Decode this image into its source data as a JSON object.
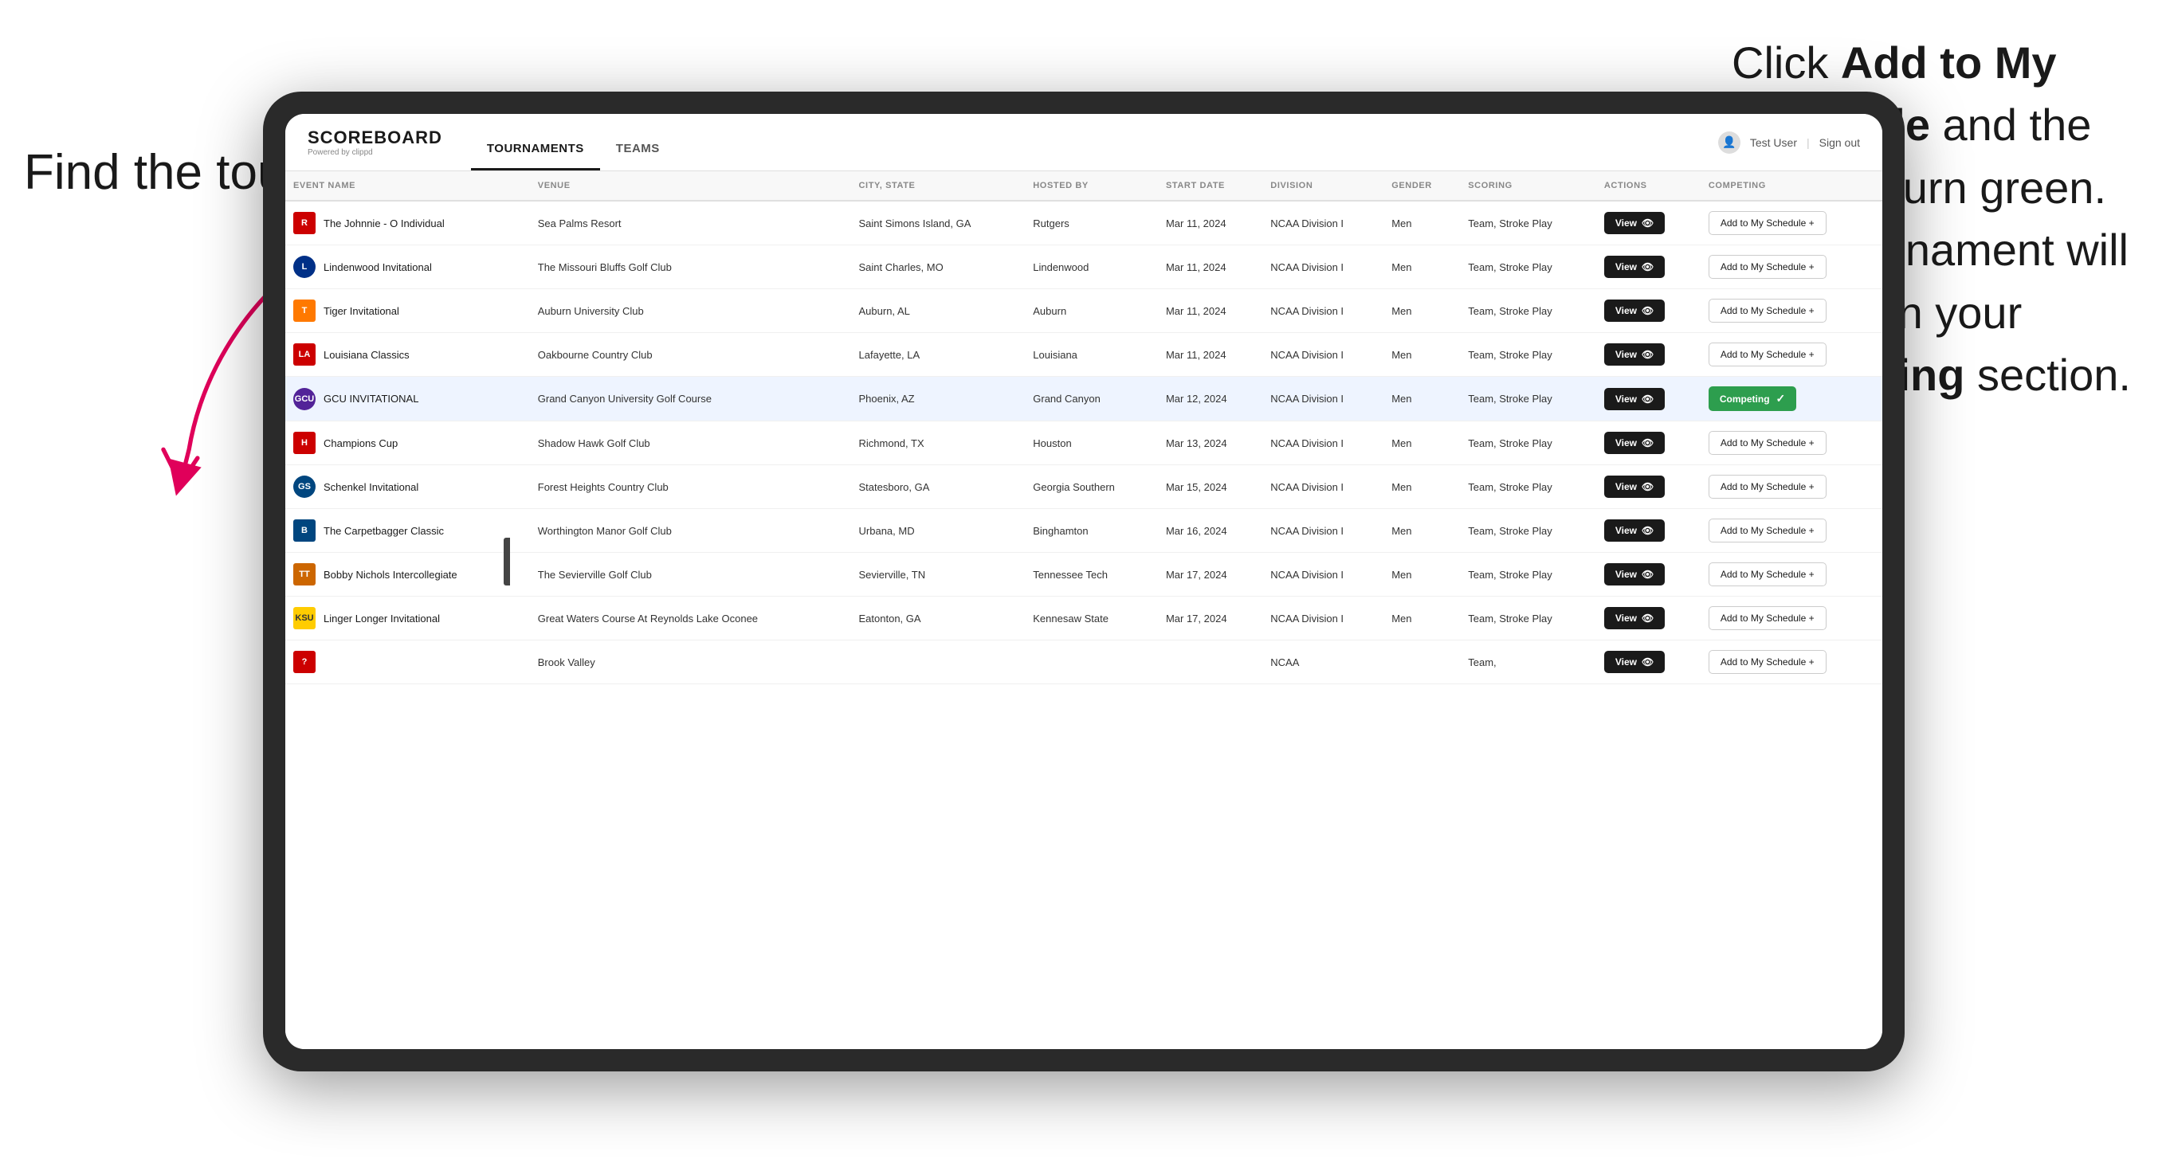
{
  "annotations": {
    "left_title": "Find the tournament.",
    "right_text_before": "Click ",
    "right_bold1": "Add to My Schedule",
    "right_text_mid": " and the box will turn green. This tournament will now be in your ",
    "right_bold2": "Competing",
    "right_text_after": " section."
  },
  "header": {
    "logo": "SCOREBOARD",
    "logo_sub": "Powered by clippd",
    "nav": [
      "TOURNAMENTS",
      "TEAMS"
    ],
    "active_nav": "TOURNAMENTS",
    "user_label": "Test User",
    "sign_out": "Sign out"
  },
  "table": {
    "columns": [
      "EVENT NAME",
      "VENUE",
      "CITY, STATE",
      "HOSTED BY",
      "START DATE",
      "DIVISION",
      "GENDER",
      "SCORING",
      "ACTIONS",
      "COMPETING"
    ],
    "rows": [
      {
        "logo": "R",
        "logo_class": "logo-r",
        "event": "The Johnnie - O Individual",
        "venue": "Sea Palms Resort",
        "city_state": "Saint Simons Island, GA",
        "hosted_by": "Rutgers",
        "start_date": "Mar 11, 2024",
        "division": "NCAA Division I",
        "gender": "Men",
        "scoring": "Team, Stroke Play",
        "highlighted": false,
        "competing": false
      },
      {
        "logo": "L",
        "logo_class": "logo-l",
        "event": "Lindenwood Invitational",
        "venue": "The Missouri Bluffs Golf Club",
        "city_state": "Saint Charles, MO",
        "hosted_by": "Lindenwood",
        "start_date": "Mar 11, 2024",
        "division": "NCAA Division I",
        "gender": "Men",
        "scoring": "Team, Stroke Play",
        "highlighted": false,
        "competing": false
      },
      {
        "logo": "T",
        "logo_class": "logo-t",
        "event": "Tiger Invitational",
        "venue": "Auburn University Club",
        "city_state": "Auburn, AL",
        "hosted_by": "Auburn",
        "start_date": "Mar 11, 2024",
        "division": "NCAA Division I",
        "gender": "Men",
        "scoring": "Team, Stroke Play",
        "highlighted": false,
        "competing": false
      },
      {
        "logo": "LA",
        "logo_class": "logo-la",
        "event": "Louisiana Classics",
        "venue": "Oakbourne Country Club",
        "city_state": "Lafayette, LA",
        "hosted_by": "Louisiana",
        "start_date": "Mar 11, 2024",
        "division": "NCAA Division I",
        "gender": "Men",
        "scoring": "Team, Stroke Play",
        "highlighted": false,
        "competing": false
      },
      {
        "logo": "GCU",
        "logo_class": "logo-gcu",
        "event": "GCU INVITATIONAL",
        "venue": "Grand Canyon University Golf Course",
        "city_state": "Phoenix, AZ",
        "hosted_by": "Grand Canyon",
        "start_date": "Mar 12, 2024",
        "division": "NCAA Division I",
        "gender": "Men",
        "scoring": "Team, Stroke Play",
        "highlighted": true,
        "competing": true
      },
      {
        "logo": "H",
        "logo_class": "logo-h",
        "event": "Champions Cup",
        "venue": "Shadow Hawk Golf Club",
        "city_state": "Richmond, TX",
        "hosted_by": "Houston",
        "start_date": "Mar 13, 2024",
        "division": "NCAA Division I",
        "gender": "Men",
        "scoring": "Team, Stroke Play",
        "highlighted": false,
        "competing": false
      },
      {
        "logo": "GS",
        "logo_class": "logo-gs",
        "event": "Schenkel Invitational",
        "venue": "Forest Heights Country Club",
        "city_state": "Statesboro, GA",
        "hosted_by": "Georgia Southern",
        "start_date": "Mar 15, 2024",
        "division": "NCAA Division I",
        "gender": "Men",
        "scoring": "Team, Stroke Play",
        "highlighted": false,
        "competing": false
      },
      {
        "logo": "B",
        "logo_class": "logo-b",
        "event": "The Carpetbagger Classic",
        "venue": "Worthington Manor Golf Club",
        "city_state": "Urbana, MD",
        "hosted_by": "Binghamton",
        "start_date": "Mar 16, 2024",
        "division": "NCAA Division I",
        "gender": "Men",
        "scoring": "Team, Stroke Play",
        "highlighted": false,
        "competing": false
      },
      {
        "logo": "TT",
        "logo_class": "logo-bobby",
        "event": "Bobby Nichols Intercollegiate",
        "venue": "The Sevierville Golf Club",
        "city_state": "Sevierville, TN",
        "hosted_by": "Tennessee Tech",
        "start_date": "Mar 17, 2024",
        "division": "NCAA Division I",
        "gender": "Men",
        "scoring": "Team, Stroke Play",
        "highlighted": false,
        "competing": false
      },
      {
        "logo": "KSU",
        "logo_class": "logo-ksu",
        "event": "Linger Longer Invitational",
        "venue": "Great Waters Course At Reynolds Lake Oconee",
        "city_state": "Eatonton, GA",
        "hosted_by": "Kennesaw State",
        "start_date": "Mar 17, 2024",
        "division": "NCAA Division I",
        "gender": "Men",
        "scoring": "Team, Stroke Play",
        "highlighted": false,
        "competing": false
      },
      {
        "logo": "?",
        "logo_class": "logo-r",
        "event": "",
        "venue": "Brook Valley",
        "city_state": "",
        "hosted_by": "",
        "start_date": "",
        "division": "NCAA",
        "gender": "",
        "scoring": "Team,",
        "highlighted": false,
        "competing": false
      }
    ]
  },
  "buttons": {
    "view": "View",
    "add_to_schedule": "Add to My Schedule",
    "add_to_schedule_plus": "+",
    "competing": "Competing",
    "competing_check": "✓"
  }
}
